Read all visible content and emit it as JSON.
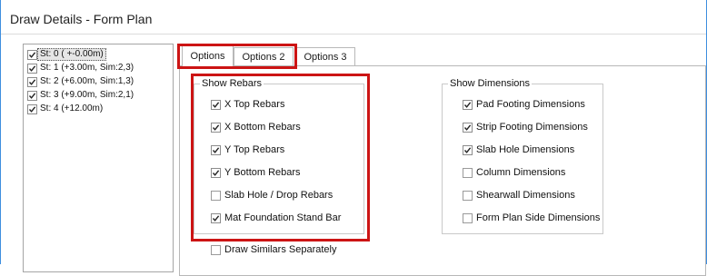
{
  "window": {
    "title": "Draw Details - Form Plan"
  },
  "stories": [
    {
      "label": "St: 0 ( +-0.00m)",
      "checked": true,
      "selected": true
    },
    {
      "label": "St: 1 (+3.00m, Sim:2,3)",
      "checked": true,
      "selected": false
    },
    {
      "label": "St: 2 (+6.00m, Sim:1,3)",
      "checked": true,
      "selected": false
    },
    {
      "label": "St: 3 (+9.00m, Sim:2,1)",
      "checked": true,
      "selected": false
    },
    {
      "label": "St: 4 (+12.00m)",
      "checked": true,
      "selected": false
    }
  ],
  "tabs": [
    {
      "label": "Options",
      "active": true
    },
    {
      "label": "Options 2",
      "active": false
    },
    {
      "label": "Options 3",
      "active": false
    }
  ],
  "show_rebars": {
    "title": "Show Rebars",
    "items": [
      {
        "label": "X Top Rebars",
        "checked": true
      },
      {
        "label": "X Bottom Rebars",
        "checked": true
      },
      {
        "label": "Y Top Rebars",
        "checked": true
      },
      {
        "label": "Y Bottom Rebars",
        "checked": true
      },
      {
        "label": "Slab Hole / Drop Rebars",
        "checked": false
      },
      {
        "label": "Mat Foundation Stand Bar",
        "checked": true
      }
    ]
  },
  "show_dimensions": {
    "title": "Show Dimensions",
    "items": [
      {
        "label": "Pad Footing Dimensions",
        "checked": true
      },
      {
        "label": "Strip Footing Dimensions",
        "checked": true
      },
      {
        "label": "Slab Hole Dimensions",
        "checked": true
      },
      {
        "label": "Column Dimensions",
        "checked": false
      },
      {
        "label": "Shearwall Dimensions",
        "checked": false
      },
      {
        "label": "Form Plan Side Dimensions",
        "checked": false
      }
    ]
  },
  "draw_similars": {
    "label": "Draw Similars Separately",
    "checked": false
  },
  "colors": {
    "highlight": "#cc1414",
    "window_border": "#3e8edf"
  }
}
